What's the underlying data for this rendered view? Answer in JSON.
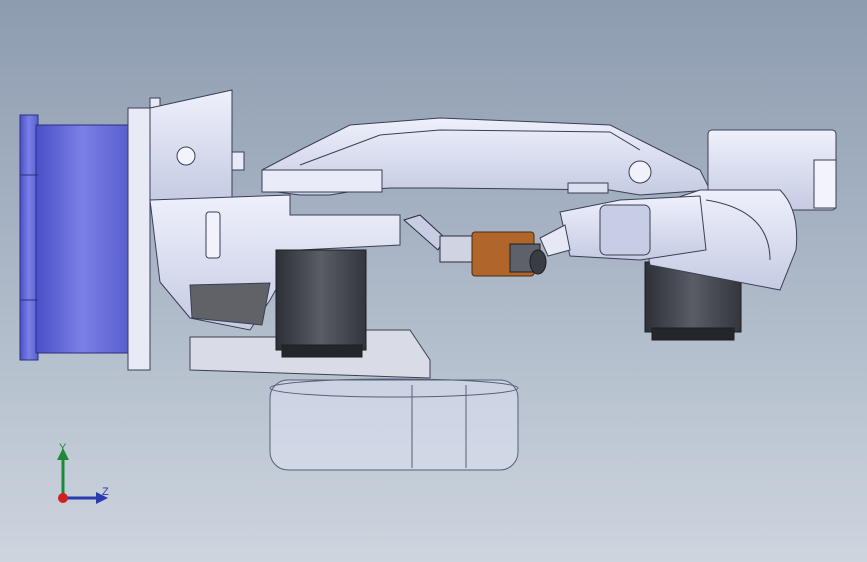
{
  "viewport": {
    "background_top": "#8e9cb0",
    "background_bottom": "#cdd5de"
  },
  "model": {
    "part_color": "#d7dbef",
    "outline_color": "#3a3f55",
    "motor_flange_color": "#5a5fd0",
    "servo_color": "#45474f",
    "tool_color": "#b0662a"
  },
  "triad": {
    "y_label": "Y",
    "z_label": "Z",
    "y_color": "#1d8a3a",
    "z_color": "#2a3bb0",
    "origin_color": "#d02020"
  }
}
